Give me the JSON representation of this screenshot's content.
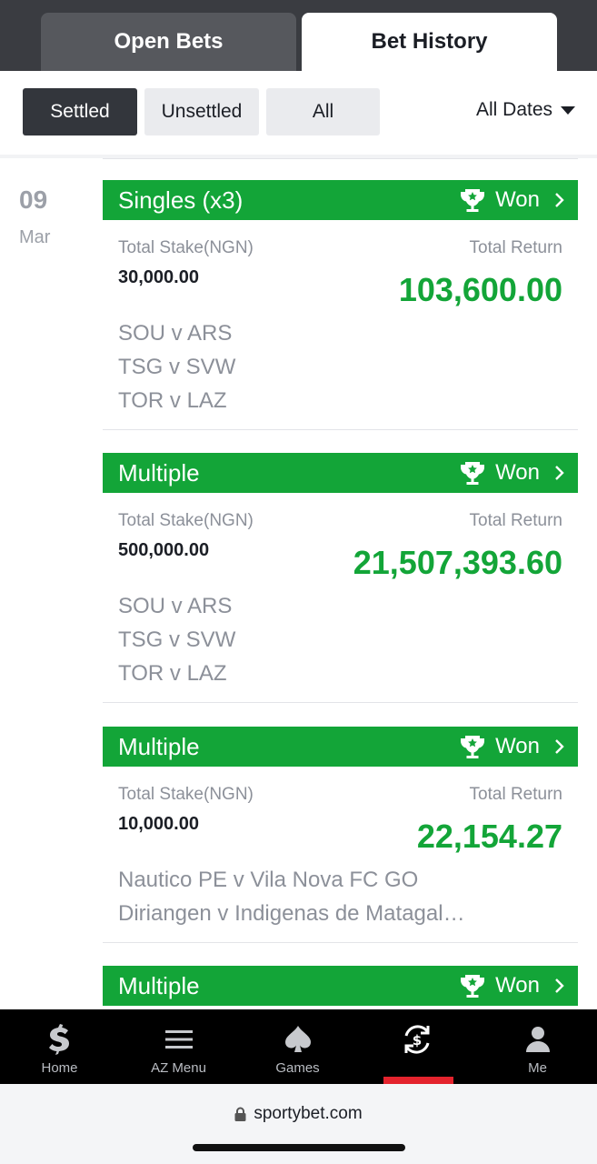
{
  "tabs": {
    "open_bets": "Open Bets",
    "bet_history": "Bet History"
  },
  "filters": {
    "settled": "Settled",
    "unsettled": "Unsettled",
    "all": "All",
    "dates": "All Dates"
  },
  "date_group": {
    "day": "09",
    "month": "Mar"
  },
  "labels": {
    "total_stake": "Total Stake(NGN)",
    "total_return": "Total Return"
  },
  "bets": [
    {
      "type": "Singles (x3)",
      "status": "Won",
      "stake": "30,000.00",
      "return": "103,600.00",
      "matches": [
        "SOU v ARS",
        "TSG v SVW",
        "TOR v LAZ"
      ]
    },
    {
      "type": "Multiple",
      "status": "Won",
      "stake": "500,000.00",
      "return": "21,507,393.60",
      "matches": [
        "SOU v ARS",
        "TSG v SVW",
        "TOR v LAZ"
      ]
    },
    {
      "type": "Multiple",
      "status": "Won",
      "stake": "10,000.00",
      "return": "22,154.27",
      "matches": [
        "Nautico PE v Vila Nova FC GO",
        "Diriangen v Indigenas de Matagal…"
      ]
    },
    {
      "type": "Multiple",
      "status": "Won"
    }
  ],
  "bottom_nav": {
    "home": "Home",
    "az_menu": "AZ Menu",
    "games": "Games",
    "me": "Me"
  },
  "browser": {
    "url": "sportybet.com"
  },
  "colors": {
    "won_green": "#13a538",
    "active_red": "#e4232d",
    "dark": "#33363c"
  }
}
